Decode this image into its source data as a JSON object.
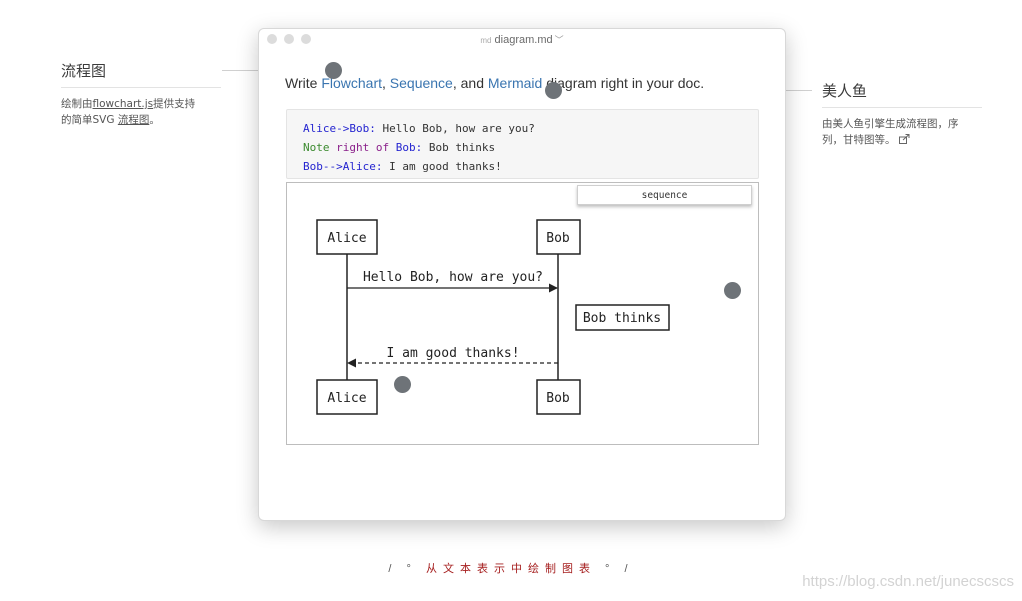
{
  "left_note": {
    "title": "流程图",
    "desc_prefix": "绘制由",
    "desc_link": "flowchart.js",
    "desc_mid": "提供支持",
    "desc_line2_prefix": "的简单SVG ",
    "desc_link2": "流程图",
    "desc_suffix": "。"
  },
  "right_note": {
    "title": "美人鱼",
    "desc_line1": "由美人鱼引擎生成流程图，序",
    "desc_line2": "列，甘特图等。",
    "icon": "external-link-icon"
  },
  "window": {
    "title": "diagram.md",
    "file_icon": "markdown-file-icon",
    "caret_icon": "chevron-down-icon"
  },
  "intro": {
    "write": "Write ",
    "flowchart": "Flowchart",
    "comma1": ", ",
    "sequence": "Sequence",
    "and": ", and ",
    "mermaid": "Mermaid",
    "rest": " diagram right in your doc."
  },
  "code": {
    "line1": {
      "from": "Alice",
      "arrow": "->",
      "to": "Bob",
      "colon": ":",
      "msg": " Hello Bob, how are you?"
    },
    "line2": {
      "note": "Note",
      "pos": " right of ",
      "who": "Bob",
      "colon": ":",
      "msg": " Bob thinks"
    },
    "line3": {
      "from": "Bob",
      "arrow": "-->",
      "to": "Alice",
      "colon": ":",
      "msg": " I am good thanks!"
    }
  },
  "diagram": {
    "tab_label": "sequence",
    "actor_a": "Alice",
    "actor_b": "Bob",
    "message1": "Hello Bob, how are you?",
    "note": "Bob thinks",
    "message2": "I am good thanks!"
  },
  "footer": {
    "slash_open": "/ ° ",
    "text": "从文本表示中绘制图表",
    "slash_close": " ° /"
  },
  "watermark": "https://blog.csdn.net/junecscscs",
  "colors": {
    "link": "#3a75b0",
    "keyword": "#2525d0",
    "note": "#3b8a2e",
    "footer_accent": "#a62020",
    "dot": "#6e7378"
  }
}
